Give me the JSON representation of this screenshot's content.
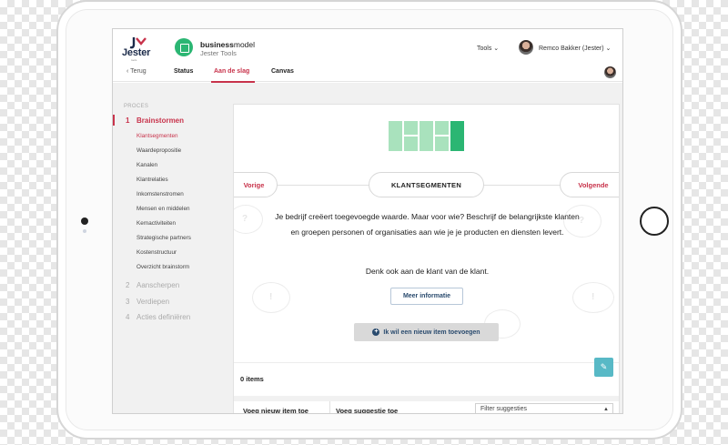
{
  "header": {
    "logo_text": "Jester",
    "logo_sub": "tools",
    "app_title_bold": "business",
    "app_title_rest": "model",
    "app_subtitle": "Jester Tools",
    "tools_menu": "Tools ⌄",
    "user_name": "Remco Bakker (Jester) ⌄"
  },
  "nav": {
    "back": "‹  Terug",
    "tabs": [
      "Status",
      "Aan de slag",
      "Canvas"
    ]
  },
  "sidebar": {
    "section": "PROCES",
    "steps": [
      {
        "num": "1",
        "label": "Brainstormen"
      },
      {
        "num": "2",
        "label": "Aanscherpen"
      },
      {
        "num": "3",
        "label": "Verdiepen"
      },
      {
        "num": "4",
        "label": "Acties definiëren"
      }
    ],
    "substeps": [
      "Klantsegmenten",
      "Waardepropositie",
      "Kanalen",
      "Klantrelaties",
      "Inkomstenstromen",
      "Mensen en middelen",
      "Kernactiviteiten",
      "Strategische partners",
      "Kostenstructuur",
      "Overzicht brainstorm"
    ]
  },
  "card": {
    "prev": "Vorige",
    "current": "KLANTSEGMENTEN",
    "next": "Volgende",
    "description": "Je bedrijf creëert toegevoegde waarde. Maar voor wie? Beschrijf de belangrijkste klanten en groepen personen of organisaties aan wie je je producten en diensten levert.",
    "hint": "Denk ook aan de klant van de klant.",
    "more_info": "Meer informatie",
    "add_item": "Ik wil een nieuw item toevoegen",
    "items_count": "0 items",
    "tab_add": "Voeg nieuw item toe",
    "tab_suggestion": "Voeg suggestie toe",
    "filter_placeholder": "Filter suggesties"
  },
  "colors": {
    "accent": "#c8334b",
    "green": "#2bb673",
    "light_green": "#a9e2bd",
    "navy": "#2a4b6e",
    "teal": "#58b9c6"
  }
}
